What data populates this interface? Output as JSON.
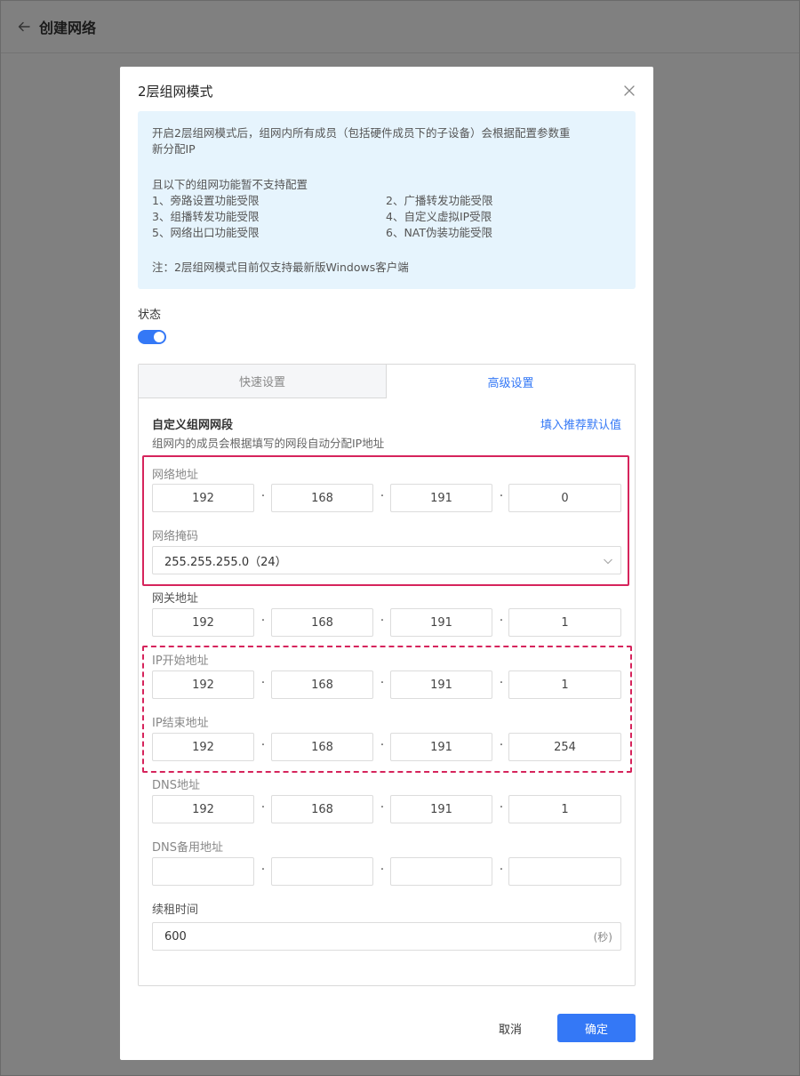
{
  "page": {
    "title": "创建网络"
  },
  "modal": {
    "title": "2层组网模式",
    "notice": {
      "line1": "开启2层组网模式后，组网内所有成员（包括硬件成员下的子设备）会根据配置参数重",
      "line2": "新分配IP",
      "unsupported_title": "且以下的组网功能暂不支持配置",
      "items": [
        "1、旁路设置功能受限",
        "2、广播转发功能受限",
        "3、组播转发功能受限",
        "4、自定义虚拟IP受限",
        "5、网络出口功能受限",
        "6、NAT伪装功能受限"
      ],
      "note": "注：2层组网模式目前仅支持最新版Windows客户端"
    },
    "status_label": "状态",
    "toggle_on": true,
    "tabs": {
      "quick": "快速设置",
      "advanced": "高级设置"
    },
    "section": {
      "title": "自定义组网网段",
      "desc": "组网内的成员会根据填写的网段自动分配IP地址",
      "fill_link": "填入推荐默认值"
    },
    "fields": {
      "network_address": {
        "label": "网络地址",
        "octets": [
          "192",
          "168",
          "191",
          "0"
        ]
      },
      "netmask": {
        "label": "网络掩码",
        "value": "255.255.255.0（24）"
      },
      "gateway": {
        "label": "网关地址",
        "octets": [
          "192",
          "168",
          "191",
          "1"
        ]
      },
      "ip_start": {
        "label": "IP开始地址",
        "octets": [
          "192",
          "168",
          "191",
          "1"
        ]
      },
      "ip_end": {
        "label": "IP结束地址",
        "octets": [
          "192",
          "168",
          "191",
          "254"
        ]
      },
      "dns": {
        "label": "DNS地址",
        "octets": [
          "192",
          "168",
          "191",
          "1"
        ]
      },
      "dns_backup": {
        "label": "DNS备用地址",
        "octets": [
          "",
          "",
          "",
          ""
        ]
      },
      "lease": {
        "label": "续租时间",
        "value": "600",
        "unit": "(秒)"
      }
    },
    "buttons": {
      "cancel": "取消",
      "ok": "确定"
    },
    "colors": {
      "accent": "#3478f6",
      "highlight": "#d6245c",
      "notice_bg": "#e6f4fd"
    }
  }
}
